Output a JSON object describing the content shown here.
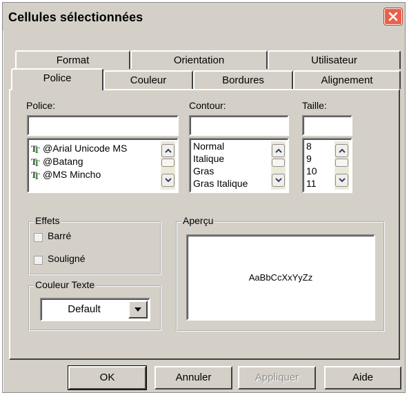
{
  "window": {
    "title": "Cellules sélectionnées"
  },
  "tabs": {
    "row1": [
      "Format",
      "Orientation",
      "Utilisateur"
    ],
    "row2": [
      "Police",
      "Couleur",
      "Bordures",
      "Alignement"
    ],
    "active": "Police"
  },
  "police": {
    "label": "Police:",
    "value": "",
    "items": [
      "@Arial Unicode MS",
      "@Batang",
      "@MS Mincho"
    ],
    "item_icon": "truetype-font-icon"
  },
  "contour": {
    "label": "Contour:",
    "value": "",
    "items": [
      "Normal",
      "Italique",
      "Gras",
      "Gras Italique"
    ]
  },
  "taille": {
    "label": "Taille:",
    "value": "",
    "items": [
      "8",
      "9",
      "10",
      "11"
    ]
  },
  "effets": {
    "label": "Effets",
    "barre": {
      "label": "Barré",
      "checked": false,
      "disabled": true
    },
    "souligne": {
      "label": "Souligné",
      "checked": false,
      "disabled": true
    }
  },
  "couleur_texte": {
    "label": "Couleur Texte",
    "value": "Default"
  },
  "apercu": {
    "label": "Aperçu",
    "sample": "AaBbCcXxYyZz"
  },
  "buttons": {
    "ok": "OK",
    "annuler": "Annuler",
    "appliquer": "Appliquer",
    "aide": "Aide"
  },
  "colors": {
    "face": "#d4d0c8",
    "close": "#e9604a",
    "disabled_text": "#8e8e8e"
  }
}
